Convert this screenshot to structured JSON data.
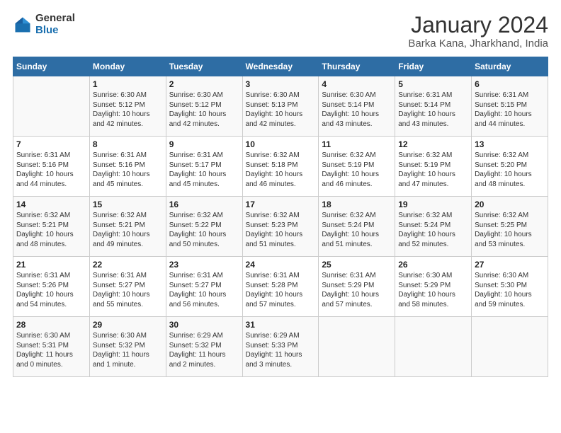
{
  "header": {
    "logo_general": "General",
    "logo_blue": "Blue",
    "title": "January 2024",
    "subtitle": "Barka Kana, Jharkhand, India"
  },
  "columns": [
    "Sunday",
    "Monday",
    "Tuesday",
    "Wednesday",
    "Thursday",
    "Friday",
    "Saturday"
  ],
  "weeks": [
    [
      {
        "day": "",
        "info": ""
      },
      {
        "day": "1",
        "info": "Sunrise: 6:30 AM\nSunset: 5:12 PM\nDaylight: 10 hours\nand 42 minutes."
      },
      {
        "day": "2",
        "info": "Sunrise: 6:30 AM\nSunset: 5:12 PM\nDaylight: 10 hours\nand 42 minutes."
      },
      {
        "day": "3",
        "info": "Sunrise: 6:30 AM\nSunset: 5:13 PM\nDaylight: 10 hours\nand 42 minutes."
      },
      {
        "day": "4",
        "info": "Sunrise: 6:30 AM\nSunset: 5:14 PM\nDaylight: 10 hours\nand 43 minutes."
      },
      {
        "day": "5",
        "info": "Sunrise: 6:31 AM\nSunset: 5:14 PM\nDaylight: 10 hours\nand 43 minutes."
      },
      {
        "day": "6",
        "info": "Sunrise: 6:31 AM\nSunset: 5:15 PM\nDaylight: 10 hours\nand 44 minutes."
      }
    ],
    [
      {
        "day": "7",
        "info": "Sunrise: 6:31 AM\nSunset: 5:16 PM\nDaylight: 10 hours\nand 44 minutes."
      },
      {
        "day": "8",
        "info": "Sunrise: 6:31 AM\nSunset: 5:16 PM\nDaylight: 10 hours\nand 45 minutes."
      },
      {
        "day": "9",
        "info": "Sunrise: 6:31 AM\nSunset: 5:17 PM\nDaylight: 10 hours\nand 45 minutes."
      },
      {
        "day": "10",
        "info": "Sunrise: 6:32 AM\nSunset: 5:18 PM\nDaylight: 10 hours\nand 46 minutes."
      },
      {
        "day": "11",
        "info": "Sunrise: 6:32 AM\nSunset: 5:19 PM\nDaylight: 10 hours\nand 46 minutes."
      },
      {
        "day": "12",
        "info": "Sunrise: 6:32 AM\nSunset: 5:19 PM\nDaylight: 10 hours\nand 47 minutes."
      },
      {
        "day": "13",
        "info": "Sunrise: 6:32 AM\nSunset: 5:20 PM\nDaylight: 10 hours\nand 48 minutes."
      }
    ],
    [
      {
        "day": "14",
        "info": "Sunrise: 6:32 AM\nSunset: 5:21 PM\nDaylight: 10 hours\nand 48 minutes."
      },
      {
        "day": "15",
        "info": "Sunrise: 6:32 AM\nSunset: 5:21 PM\nDaylight: 10 hours\nand 49 minutes."
      },
      {
        "day": "16",
        "info": "Sunrise: 6:32 AM\nSunset: 5:22 PM\nDaylight: 10 hours\nand 50 minutes."
      },
      {
        "day": "17",
        "info": "Sunrise: 6:32 AM\nSunset: 5:23 PM\nDaylight: 10 hours\nand 51 minutes."
      },
      {
        "day": "18",
        "info": "Sunrise: 6:32 AM\nSunset: 5:24 PM\nDaylight: 10 hours\nand 51 minutes."
      },
      {
        "day": "19",
        "info": "Sunrise: 6:32 AM\nSunset: 5:24 PM\nDaylight: 10 hours\nand 52 minutes."
      },
      {
        "day": "20",
        "info": "Sunrise: 6:32 AM\nSunset: 5:25 PM\nDaylight: 10 hours\nand 53 minutes."
      }
    ],
    [
      {
        "day": "21",
        "info": "Sunrise: 6:31 AM\nSunset: 5:26 PM\nDaylight: 10 hours\nand 54 minutes."
      },
      {
        "day": "22",
        "info": "Sunrise: 6:31 AM\nSunset: 5:27 PM\nDaylight: 10 hours\nand 55 minutes."
      },
      {
        "day": "23",
        "info": "Sunrise: 6:31 AM\nSunset: 5:27 PM\nDaylight: 10 hours\nand 56 minutes."
      },
      {
        "day": "24",
        "info": "Sunrise: 6:31 AM\nSunset: 5:28 PM\nDaylight: 10 hours\nand 57 minutes."
      },
      {
        "day": "25",
        "info": "Sunrise: 6:31 AM\nSunset: 5:29 PM\nDaylight: 10 hours\nand 57 minutes."
      },
      {
        "day": "26",
        "info": "Sunrise: 6:30 AM\nSunset: 5:29 PM\nDaylight: 10 hours\nand 58 minutes."
      },
      {
        "day": "27",
        "info": "Sunrise: 6:30 AM\nSunset: 5:30 PM\nDaylight: 10 hours\nand 59 minutes."
      }
    ],
    [
      {
        "day": "28",
        "info": "Sunrise: 6:30 AM\nSunset: 5:31 PM\nDaylight: 11 hours\nand 0 minutes."
      },
      {
        "day": "29",
        "info": "Sunrise: 6:30 AM\nSunset: 5:32 PM\nDaylight: 11 hours\nand 1 minute."
      },
      {
        "day": "30",
        "info": "Sunrise: 6:29 AM\nSunset: 5:32 PM\nDaylight: 11 hours\nand 2 minutes."
      },
      {
        "day": "31",
        "info": "Sunrise: 6:29 AM\nSunset: 5:33 PM\nDaylight: 11 hours\nand 3 minutes."
      },
      {
        "day": "",
        "info": ""
      },
      {
        "day": "",
        "info": ""
      },
      {
        "day": "",
        "info": ""
      }
    ]
  ]
}
